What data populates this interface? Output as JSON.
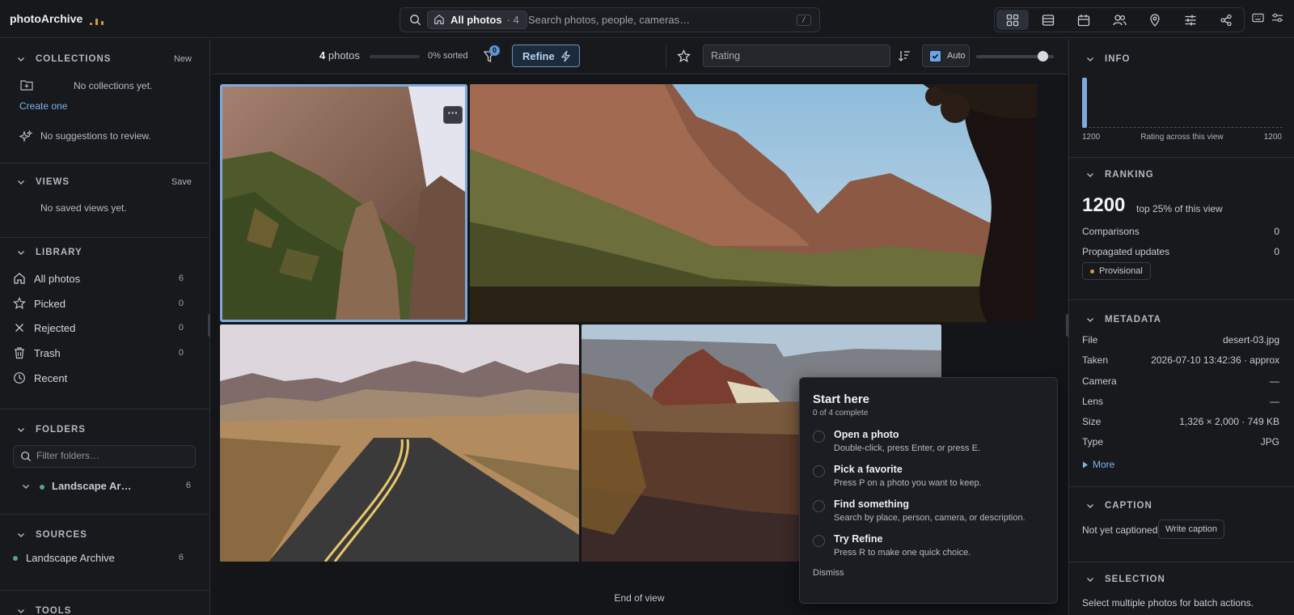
{
  "app": {
    "title": "photoArchive"
  },
  "search": {
    "scope_label": "All photos",
    "scope_count": "· 4",
    "placeholder": "Search photos, people, cameras…",
    "shortcut": "/"
  },
  "view_tabs": [
    "grid-icon",
    "list-icon",
    "calendar-icon",
    "people-icon",
    "map-pin-icon",
    "sliders-icon",
    "share-icon"
  ],
  "top_right_icons": [
    "keyboard-icon",
    "settings-icon"
  ],
  "sidebar": {
    "collections": {
      "title": "COLLECTIONS",
      "action": "New",
      "empty": "No collections yet.",
      "create_link": "Create one",
      "suggestions": "No suggestions to review."
    },
    "views": {
      "title": "VIEWS",
      "action": "Save",
      "empty": "No saved views yet."
    },
    "library": {
      "title": "LIBRARY",
      "items": [
        {
          "label": "All photos",
          "count": "6",
          "icon": "home-icon"
        },
        {
          "label": "Picked",
          "count": "0",
          "icon": "star-icon"
        },
        {
          "label": "Rejected",
          "count": "0",
          "icon": "x-icon"
        },
        {
          "label": "Trash",
          "count": "0",
          "icon": "trash-icon"
        },
        {
          "label": "Recent",
          "count": "",
          "icon": "clock-icon"
        }
      ]
    },
    "folders": {
      "title": "FOLDERS",
      "placeholder": "Filter folders…",
      "items": [
        {
          "label": "Landscape Ar…",
          "count": "6"
        }
      ]
    },
    "sources": {
      "title": "SOURCES",
      "items": [
        {
          "label": "Landscape Archive",
          "count": "6"
        }
      ]
    },
    "tools": {
      "title": "TOOLS"
    }
  },
  "toolbar": {
    "photo_count": "4",
    "photo_label": "photos",
    "sorted_text": "0% sorted",
    "sorted_fraction": 0,
    "filter_badge": "0",
    "refine_label": "Refine",
    "rating_select": "Rating",
    "auto_label": "Auto",
    "auto_checked": true,
    "size_fraction": 0.85
  },
  "grid": {
    "end_text": "End of view"
  },
  "start_card": {
    "title": "Start here",
    "progress": "0 of 4 complete",
    "tasks": [
      {
        "title": "Open a photo",
        "desc": "Double-click, press Enter, or press E."
      },
      {
        "title": "Pick a favorite",
        "desc": "Press P on a photo you want to keep."
      },
      {
        "title": "Find something",
        "desc": "Search by place, person, camera, or description."
      },
      {
        "title": "Try Refine",
        "desc": "Press R to make one quick choice."
      }
    ],
    "dismiss": "Dismiss"
  },
  "info": {
    "title": "INFO",
    "min": "1200",
    "caption": "Rating across this view",
    "max": "1200"
  },
  "ranking": {
    "title": "RANKING",
    "score": "1200",
    "note": "top 25% of this view",
    "rows": [
      {
        "k": "Comparisons",
        "v": "0"
      },
      {
        "k": "Propagated updates",
        "v": "0"
      }
    ],
    "status": "Provisional"
  },
  "metadata": {
    "title": "METADATA",
    "rows": [
      {
        "k": "File",
        "v": "desert-03.jpg"
      },
      {
        "k": "Taken",
        "v": "2026-07-10 13:42:36 · approx"
      },
      {
        "k": "Camera",
        "v": "—"
      },
      {
        "k": "Lens",
        "v": "—"
      },
      {
        "k": "Size",
        "v": "1,326 × 2,000 · 749 KB"
      },
      {
        "k": "Type",
        "v": "JPG"
      }
    ],
    "more": "More"
  },
  "caption": {
    "title": "CAPTION",
    "empty": "Not yet captioned",
    "button": "Write caption"
  },
  "selection": {
    "title": "SELECTION",
    "text": "Select multiple photos for batch actions."
  },
  "colors": {
    "accent": "#6ba6e8",
    "provisional": "#d8983e",
    "folder_dot": "#5aa08a"
  }
}
